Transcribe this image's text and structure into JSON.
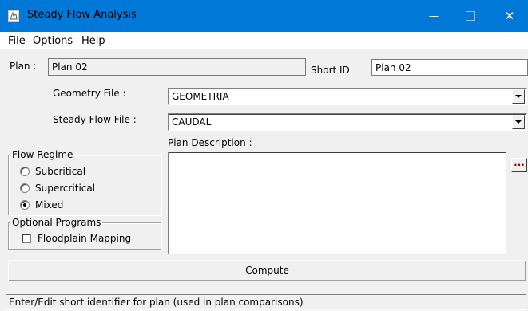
{
  "window": {
    "title": "Steady Flow Analysis",
    "minimize_glyph": "—",
    "close_glyph": "✕"
  },
  "menu": [
    "File",
    "Options",
    "Help"
  ],
  "plan": {
    "label": "Plan :",
    "value": "Plan 02",
    "short_id_label": "Short ID",
    "short_id_value": "Plan 02"
  },
  "geometry": {
    "label": "Geometry File :",
    "value": "GEOMETRIA"
  },
  "steady_flow": {
    "label": "Steady Flow File :",
    "value": "CAUDAL"
  },
  "flow_regime": {
    "legend": "Flow Regime",
    "options": [
      "Subcritical",
      "Supercritical",
      "Mixed"
    ],
    "selected": "Mixed"
  },
  "optional_programs": {
    "legend": "Optional Programs",
    "floodplain_label": "Floodplain Mapping",
    "floodplain_checked": false
  },
  "description": {
    "label": "Plan Description :",
    "ellipsis": "..."
  },
  "compute_label": "Compute",
  "status": "Enter/Edit short identifier for plan (used in plan comparisons)",
  "colors": {
    "titlebar": "#0078d7",
    "background": "#f0f0f0",
    "ellipsis_text": "#a00000"
  }
}
